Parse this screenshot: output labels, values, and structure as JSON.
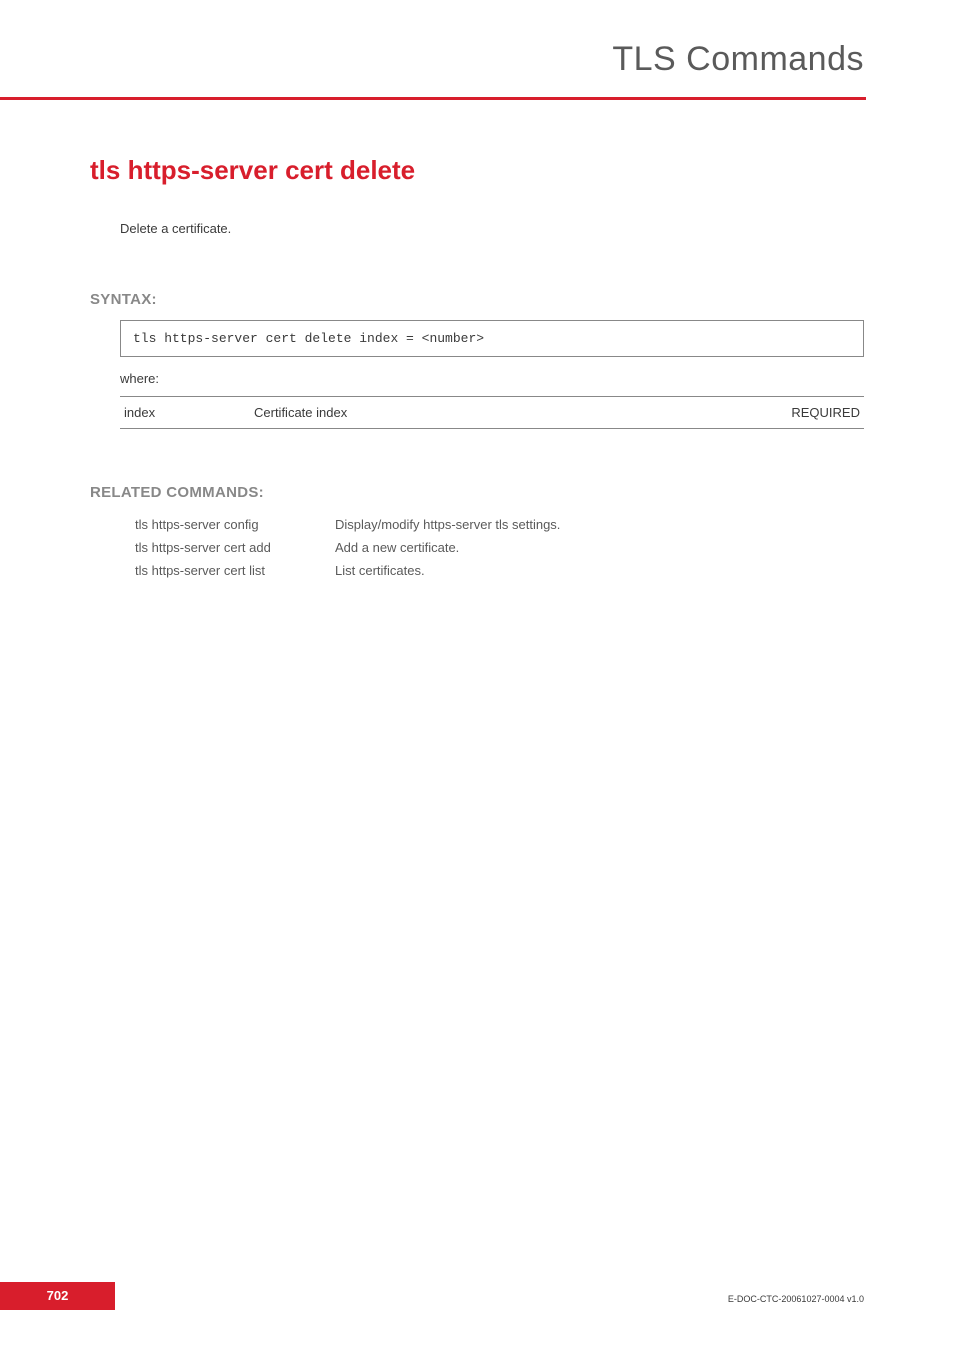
{
  "header": {
    "title": "TLS Commands"
  },
  "section": {
    "title": "tls https-server cert delete",
    "description": "Delete a certificate."
  },
  "syntax": {
    "label": "SYNTAX:",
    "command": "tls https-server cert delete   index = <number>",
    "whereLabel": "where:",
    "params": [
      {
        "name": "index",
        "desc": "Certificate index",
        "req": "REQUIRED"
      }
    ]
  },
  "related": {
    "label": "RELATED COMMANDS:",
    "items": [
      {
        "cmd": "tls https-server config",
        "desc": "Display/modify https-server tls settings."
      },
      {
        "cmd": "tls https-server cert add",
        "desc": "Add a new certificate."
      },
      {
        "cmd": "tls https-server cert list",
        "desc": "List certificates."
      }
    ]
  },
  "footer": {
    "page": "702",
    "docid": "E-DOC-CTC-20061027-0004 v1.0"
  }
}
